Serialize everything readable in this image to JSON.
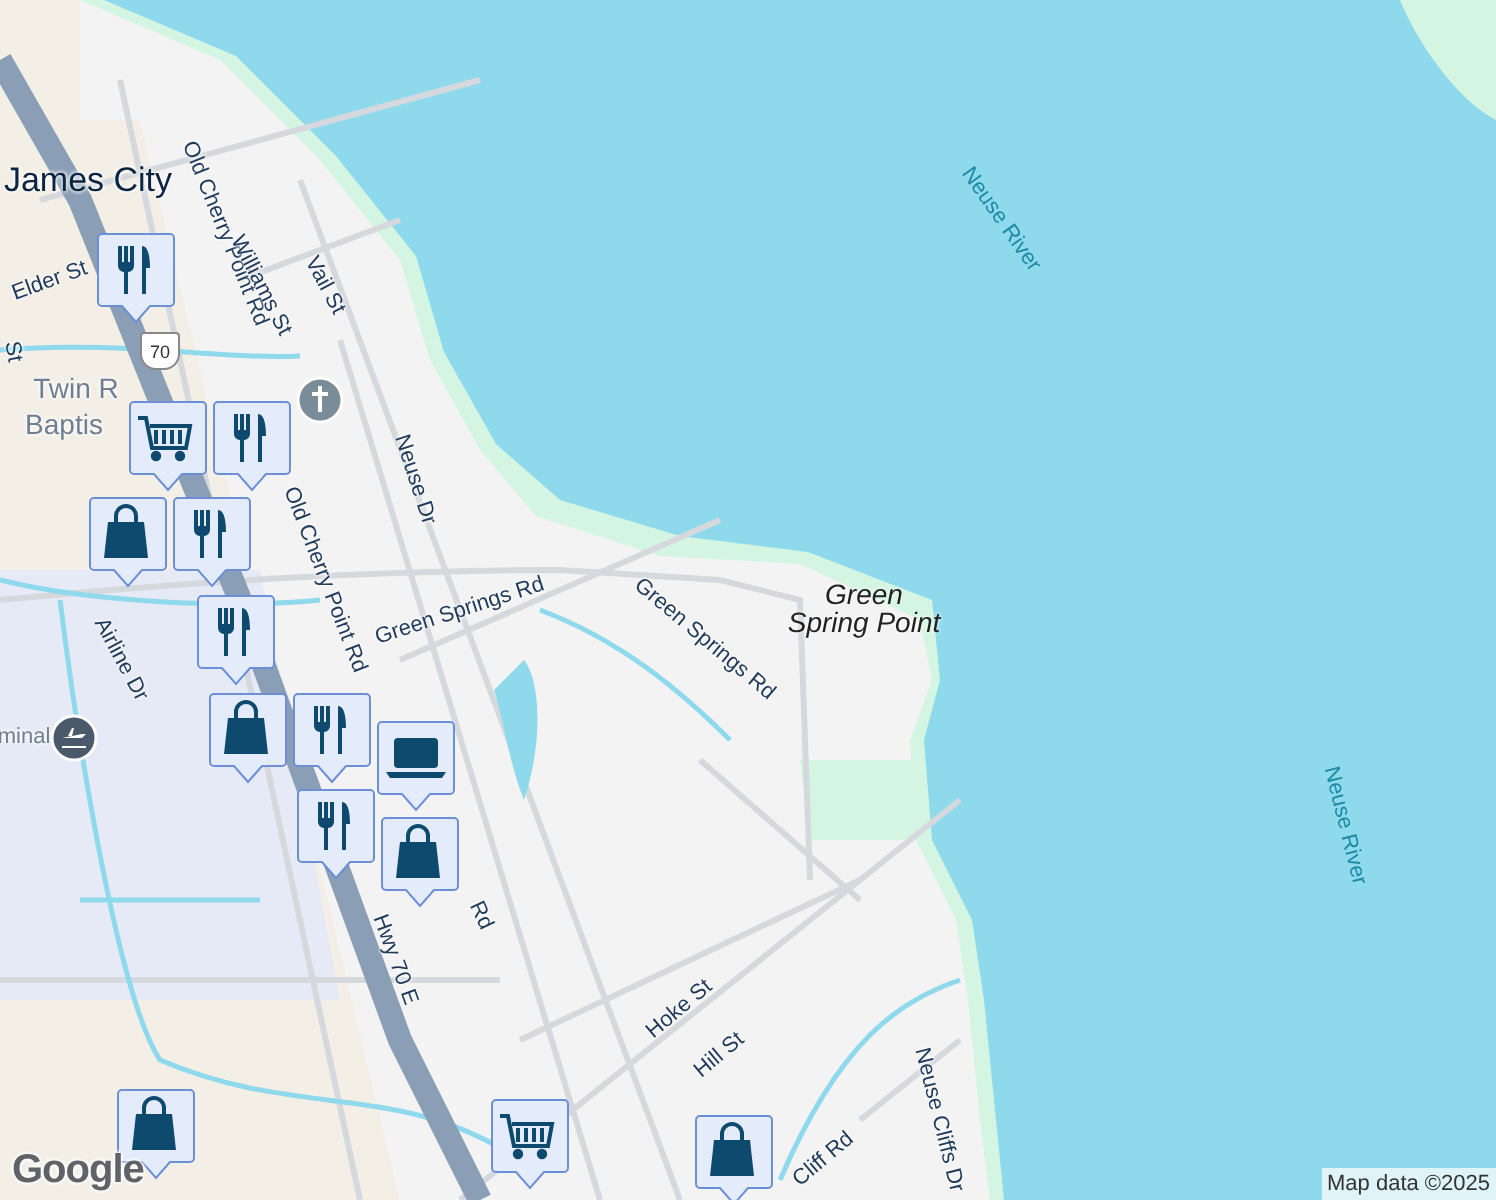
{
  "map": {
    "labels": [
      {
        "text": "James City",
        "kind": "town"
      },
      {
        "text": "Elder St",
        "kind": "street"
      },
      {
        "text": "St",
        "kind": "street"
      },
      {
        "text": "Old Cherry Point Rd",
        "kind": "street"
      },
      {
        "text": "Williams St",
        "kind": "street"
      },
      {
        "text": "Vail St",
        "kind": "street"
      },
      {
        "text": "Twin R",
        "kind": "poi"
      },
      {
        "text": "Baptis",
        "kind": "poi"
      },
      {
        "text": "Old Cherry Point Rd",
        "kind": "street"
      },
      {
        "text": "Neuse Dr",
        "kind": "street"
      },
      {
        "text": "Green Springs Rd",
        "kind": "street"
      },
      {
        "text": "Green Springs Rd",
        "kind": "street"
      },
      {
        "text": "Airline Dr",
        "kind": "street"
      },
      {
        "text": "minal",
        "kind": "poi"
      },
      {
        "text": "Rd",
        "kind": "street"
      },
      {
        "text": "Hwy 70 E",
        "kind": "street"
      },
      {
        "text": "Hoke St",
        "kind": "street"
      },
      {
        "text": "Hill St",
        "kind": "street"
      },
      {
        "text": "Cliff Rd",
        "kind": "street"
      },
      {
        "text": "Neuse Cliffs Dr",
        "kind": "street"
      },
      {
        "text": "Green Spring Point",
        "kind": "place"
      },
      {
        "text": "Neuse River",
        "kind": "water"
      },
      {
        "text": "Neuse River",
        "kind": "water"
      }
    ],
    "shield": "70",
    "pins": [
      {
        "kind": "church"
      },
      {
        "kind": "airport"
      }
    ],
    "markers": [
      {
        "kind": "restaurant"
      },
      {
        "kind": "grocery"
      },
      {
        "kind": "restaurant"
      },
      {
        "kind": "shopping"
      },
      {
        "kind": "restaurant"
      },
      {
        "kind": "restaurant"
      },
      {
        "kind": "shopping"
      },
      {
        "kind": "restaurant"
      },
      {
        "kind": "laptop"
      },
      {
        "kind": "shopping"
      },
      {
        "kind": "restaurant"
      },
      {
        "kind": "shopping"
      },
      {
        "kind": "grocery"
      },
      {
        "kind": "shopping"
      }
    ],
    "logo": "Google",
    "attribution": "Map data ©2025"
  }
}
